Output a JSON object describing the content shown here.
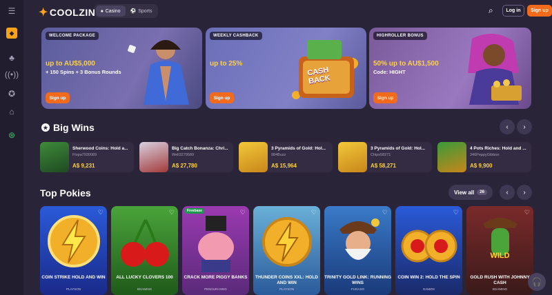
{
  "header": {
    "logo": "COOLZINO",
    "tabs": [
      "Casino",
      "Sports"
    ],
    "login": "Log in",
    "signup": "Sign up"
  },
  "banners": [
    {
      "tag": "WELCOME PACKAGE",
      "line1": "up to AU$5,000",
      "line2": "+ 150 Spins + 3 Bonus Rounds",
      "btn": "Sign up"
    },
    {
      "tag": "WEEKLY CASHBACK",
      "line1": "up to 25%",
      "line2": "",
      "btn": "Sign up",
      "art": "CASH BACK"
    },
    {
      "tag": "HIGHROLLER BONUS",
      "line1": "50% up to AU$1,500",
      "line2": "Code: HIGHT",
      "btn": "Sign up"
    }
  ],
  "big_wins": {
    "title": "Big Wins",
    "items": [
      {
        "title": "Sherwood Coins: Hold a...",
        "user": "Flopa7930089",
        "amount": "A$ 9,231"
      },
      {
        "title": "Big Catch Bonanza: Chri...",
        "user": "Well3279589",
        "amount": "A$ 27,780"
      },
      {
        "title": "3 Pyramids of Gold: Hol...",
        "user": "984Buzz",
        "amount": "A$ 15,964"
      },
      {
        "title": "3 Pyramids of Gold: Hol...",
        "user": "Chips58271",
        "amount": "A$ 58,271"
      },
      {
        "title": "4 Pots Riches: Hold and ...",
        "user": "346PeppyGibbon",
        "amount": "A$ 9,900"
      }
    ]
  },
  "top_pokies": {
    "title": "Top Pokies",
    "view_all": "View all",
    "count": "26",
    "games": [
      {
        "title": "COIN STRIKE HOLD AND WIN",
        "provider": "PLAYSON",
        "tag": ""
      },
      {
        "title": "ALL LUCKY CLOVERS 100",
        "provider": "BGAMING",
        "tag": ""
      },
      {
        "title": "CRACK MORE PIGGY BANKS",
        "provider": "PENGUIN KING",
        "tag": "Freebase"
      },
      {
        "title": "THUNDER COINS XXL: HOLD AND WIN",
        "provider": "PLAYSON",
        "tag": ""
      },
      {
        "title": "TRINITY GOLD LINK: RUNNING WINS",
        "provider": "FUGASO",
        "tag": ""
      },
      {
        "title": "COIN WIN 2: HOLD THE SPIN",
        "provider": "GAMZIX",
        "tag": ""
      },
      {
        "title": "GOLD RUSH WITH JOHNNY CASH",
        "provider": "BGAMING",
        "tag": ""
      }
    ]
  },
  "card_art": {
    "wild": "WILD"
  }
}
